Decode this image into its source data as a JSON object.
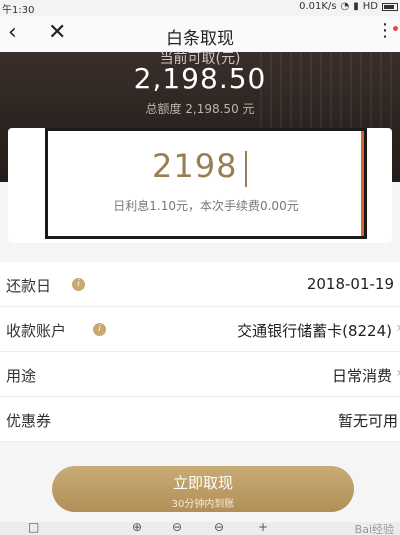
{
  "status_bar": {
    "time": "午1:30",
    "net_speed": "0.01K/s",
    "signal": "HD"
  },
  "nav": {
    "back_icon": "chevron-left-icon",
    "close_icon": "close-icon",
    "title": "白条取现",
    "more_icon": "more-icon"
  },
  "hero": {
    "label": "当前可取(元)",
    "amount": "2,198.50",
    "total": "总额度 2,198.50 元"
  },
  "input": {
    "value": "2198",
    "hint": "日利息1.10元，本次手续费0.00元"
  },
  "rows": [
    {
      "label": "还款日",
      "value": "2018-01-19"
    },
    {
      "label": "收款账户",
      "value": "交通银行储蓄卡(8224)"
    },
    {
      "label": "用途",
      "value": "日常消费"
    },
    {
      "label": "优惠券",
      "value": "暂无可用"
    }
  ],
  "cta": {
    "main": "立即取现",
    "sub": "30分钟内到账"
  },
  "watermark": "Bai经验",
  "colors": {
    "accent_gold": "#b8955e",
    "hero_dark": "#2b2320",
    "notice_red": "#e24a3b"
  }
}
